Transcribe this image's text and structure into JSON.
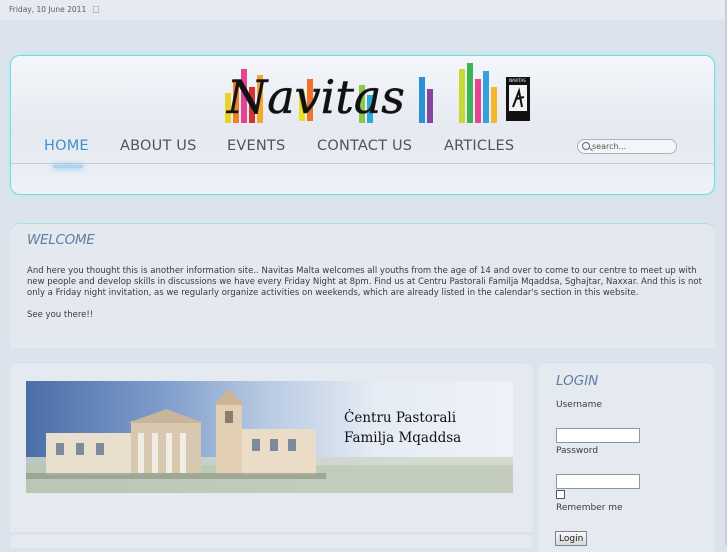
{
  "topbar": {
    "date": "Friday, 10 June 2011"
  },
  "brand": {
    "logo_text": "Navitas",
    "badge_text": "NAVITAS"
  },
  "nav": {
    "items": [
      "HOME",
      "ABOUT US",
      "EVENTS",
      "CONTACT US",
      "ARTICLES"
    ],
    "active": "HOME"
  },
  "search": {
    "placeholder": "search..."
  },
  "welcome": {
    "title": "WELCOME",
    "body": "And here you thought this is another information site.. Navitas Malta welcomes all youths from the age of 14 and over to come to our centre to meet up with new people and develop skills in discussions we have every Friday Night at 8pm. Find us at Centru Pastorali Familja Mqaddsa, Sghajtar, Naxxar. And this is not only a Friday night invitation, as we regularly organize activities on weekends, which are already listed in the calendar's section in this website.",
    "signoff": "See you there!!"
  },
  "banner": {
    "line1": "Ċentru Pastorali",
    "line2": "Familja Mqaddsa"
  },
  "login": {
    "title": "LOGIN",
    "username_label": "Username",
    "username_value": "",
    "password_label": "Password",
    "password_value": "",
    "remember_label": "Remember me",
    "submit_label": "Login"
  },
  "colors": {
    "accent": "#3e8fd0",
    "heading": "#5f7ea4",
    "frame_glow": "#7ad7df"
  }
}
